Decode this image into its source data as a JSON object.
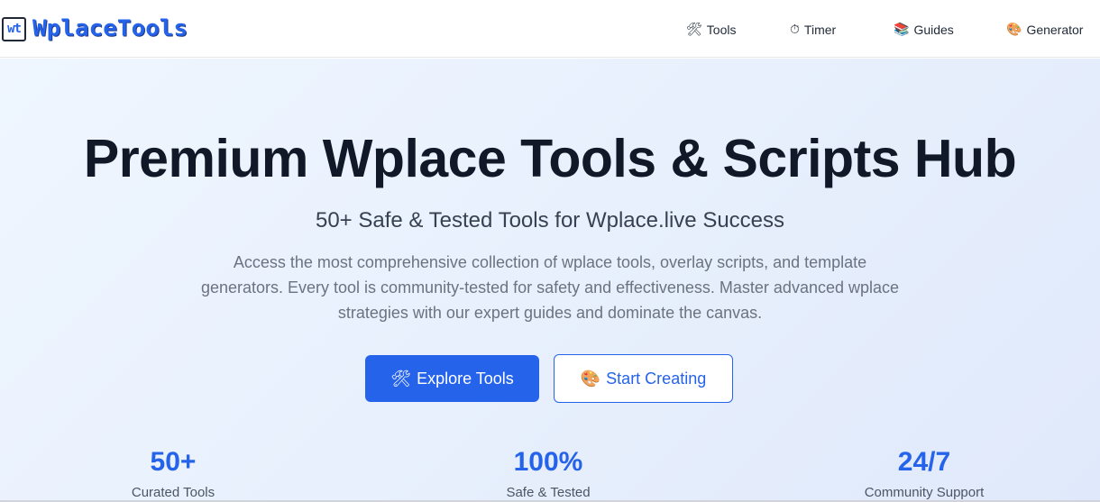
{
  "header": {
    "logo_badge": "wt",
    "logo_text": "WplaceTools",
    "nav": [
      {
        "icon": "🛠",
        "label": "Tools"
      },
      {
        "icon": "⏱",
        "label": "Timer"
      },
      {
        "icon": "📚",
        "label": "Guides"
      },
      {
        "icon": "🎨",
        "label": "Generator"
      }
    ]
  },
  "hero": {
    "title": "Premium Wplace Tools & Scripts Hub",
    "subtitle": "50+ Safe & Tested Tools for Wplace.live Success",
    "description": "Access the most comprehensive collection of wplace tools, overlay scripts, and template generators. Every tool is community-tested for safety and effectiveness. Master advanced wplace strategies with our expert guides and dominate the canvas.",
    "primary_button": {
      "icon": "🛠",
      "label": "Explore Tools"
    },
    "secondary_button": {
      "icon": "🎨",
      "label": "Start Creating"
    },
    "stats": [
      {
        "value": "50+",
        "label": "Curated Tools"
      },
      {
        "value": "100%",
        "label": "Safe & Tested"
      },
      {
        "value": "24/7",
        "label": "Community Support"
      }
    ]
  },
  "colors": {
    "accent": "#2563eb",
    "title": "#111827",
    "muted": "#6b7280"
  }
}
